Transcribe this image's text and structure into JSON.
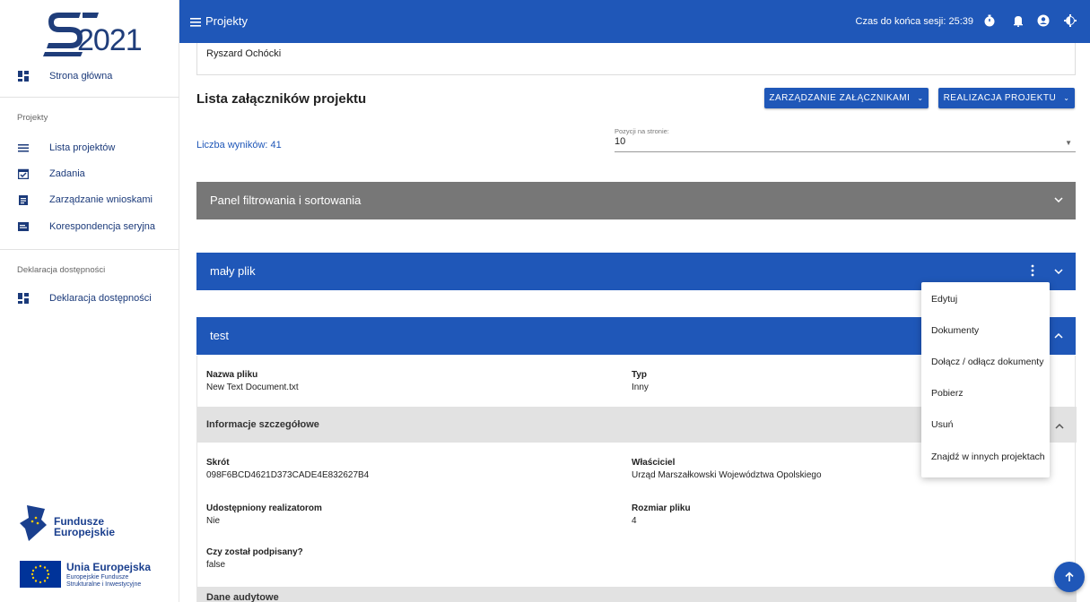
{
  "sidebar": {
    "logo_text": "2021",
    "items": [
      {
        "label": "Strona główna",
        "icon": "dashboard-icon"
      },
      {
        "label": "Lista projektów",
        "icon": "list-icon"
      },
      {
        "label": "Zadania",
        "icon": "calendar-check-icon"
      },
      {
        "label": "Zarządzanie wnioskami",
        "icon": "clipboard-icon"
      },
      {
        "label": "Korespondencja seryjna",
        "icon": "mail-merge-icon"
      },
      {
        "label": "Deklaracja dostępności",
        "icon": "dashboard-icon"
      }
    ],
    "section_projekty": "Projekty",
    "section_deklaracja": "Deklaracja dostępności",
    "fe_logo": {
      "line1": "Fundusze",
      "line2": "Europejskie"
    },
    "eu_logo": {
      "title": "Unia Europejska",
      "line1": "Europejskie Fundusze",
      "line2": "Strukturalne i Inwestycyjne"
    }
  },
  "topbar": {
    "title": "Projekty",
    "session_text": "Czas do końca sesji: 25:39"
  },
  "top_card": {
    "text": "Ryszard Ochócki"
  },
  "page": {
    "heading": "Lista załączników projektu",
    "btn_attachments": "ZARZĄDZANIE ZAŁĄCZNIKAMI",
    "btn_realization": "REALIZACJA PROJEKTU",
    "result_count": "Liczba wyników: 41",
    "per_page_label": "Pozycji na stronie:",
    "per_page_value": "10",
    "filter_panel": "Panel filtrowania i sortowania"
  },
  "attachments": [
    {
      "title": "mały plik"
    },
    {
      "title": "test"
    }
  ],
  "details": {
    "file_name_label": "Nazwa pliku",
    "file_name_value": "New Text Document.txt",
    "type_label": "Typ",
    "type_value": "Inny",
    "info_section": "Informacje szczegółowe",
    "hash_label": "Skrót",
    "hash_value": "098F6BCD4621D373CADE4E832627B4",
    "owner_label": "Właściciel",
    "owner_value": "Urząd Marszałkowski Województwa Opolskiego",
    "shared_label": "Udostępniony realizatorom",
    "shared_value": "Nie",
    "size_label": "Rozmiar pliku",
    "size_value": "4",
    "signed_label": "Czy został podpisany?",
    "signed_value": "false",
    "audit_section": "Dane audytowe"
  },
  "menu": {
    "items": [
      "Edytuj",
      "Dokumenty",
      "Dołącz / odłącz dokumenty",
      "Pobierz",
      "Usuń",
      "Znajdź w innych projektach"
    ]
  },
  "colors": {
    "primary": "#1f57b8",
    "filter_panel": "#777777",
    "section_bar": "#e2e2e2"
  }
}
